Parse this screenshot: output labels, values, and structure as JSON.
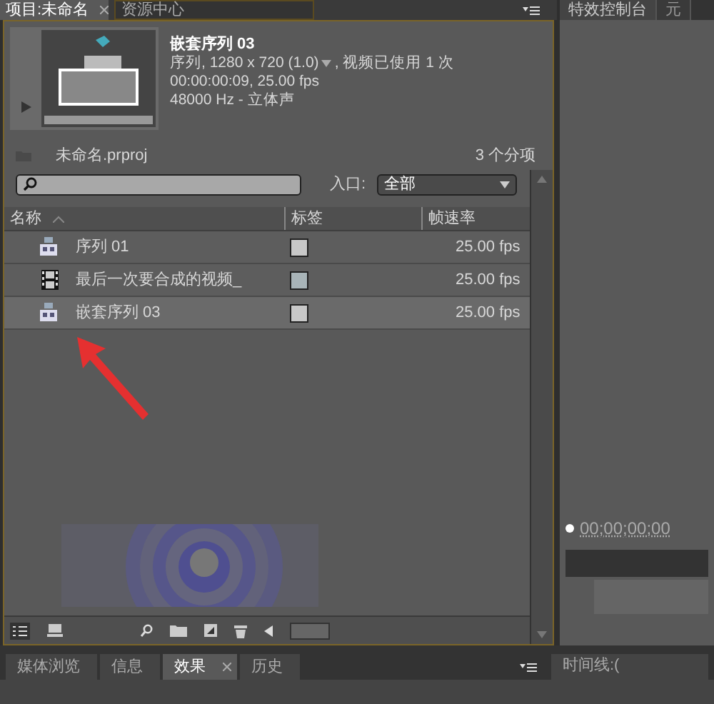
{
  "project_panel": {
    "tabs": [
      {
        "label": "项目:未命名",
        "selected": true,
        "closable": true
      },
      {
        "label": "资源中心",
        "selected": false,
        "closable": false
      }
    ],
    "preview": {
      "title": "嵌套序列 03",
      "info": "序列, 1280 x 720 (1.0)",
      "usage": ", 视频已使用 1 次",
      "duration": "00:00:00:09, 25.00 fps",
      "audio": "48000 Hz - 立体声"
    },
    "project_file": "未命名.prproj",
    "item_count": "3 个分项",
    "entry_label": "入口:",
    "entry_value": "全部",
    "columns": [
      "名称",
      "标签",
      "帧速率"
    ],
    "rows": [
      {
        "kind": "sequence",
        "name": "序列 01",
        "color": "#c8c8c8",
        "fps": "25.00 fps",
        "selected": false
      },
      {
        "kind": "video",
        "name": "最后一次要合成的视频_",
        "color": "#a8b4b8",
        "fps": "25.00 fps",
        "selected": false
      },
      {
        "kind": "sequence",
        "name": "嵌套序列 03",
        "color": "#c8c8c8",
        "fps": "25.00 fps",
        "selected": true
      }
    ]
  },
  "effects_panel": {
    "tabs": [
      {
        "label": "特效控制台",
        "selected": true
      },
      {
        "label": "元",
        "selected": false
      }
    ],
    "timecode": "00;00;00;00"
  },
  "bottom_tabs": [
    {
      "label": "媒体浏览",
      "selected": false,
      "closable": false
    },
    {
      "label": "信息",
      "selected": false,
      "closable": false
    },
    {
      "label": "效果",
      "selected": true,
      "closable": true
    },
    {
      "label": "历史",
      "selected": false,
      "closable": false
    }
  ],
  "timeline_tab": {
    "label": "时间线:("
  }
}
